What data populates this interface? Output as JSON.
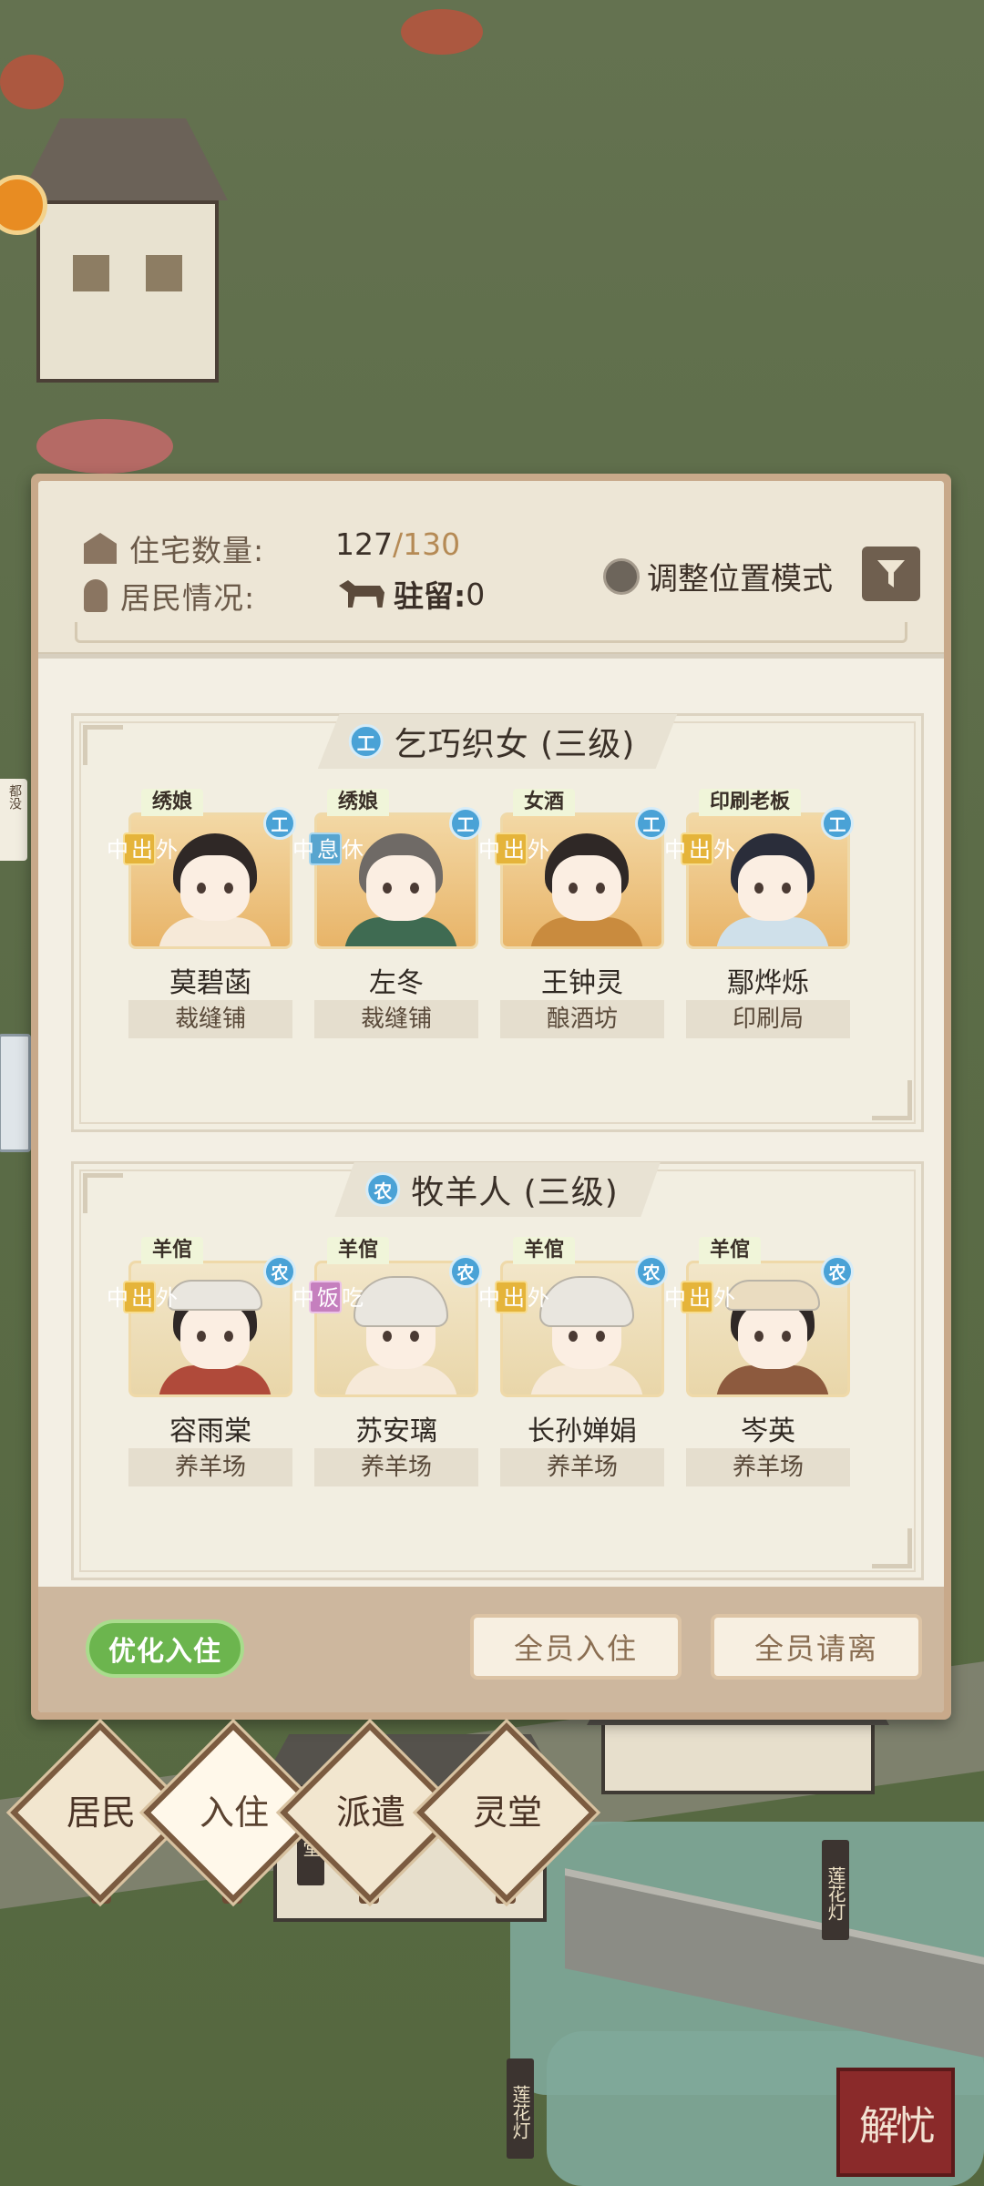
{
  "header": {
    "housing_label": "住宅数量:",
    "housing_count": "127",
    "housing_max": "/130",
    "residents_label": "居民情况:",
    "stay_label": "驻留:",
    "stay_value": "0",
    "adjust_mode_label": "调整位置模式"
  },
  "groups": [
    {
      "badge": "工",
      "title": "乞巧织女 (三级)",
      "members": [
        {
          "job": "绣娘",
          "status": "外出中",
          "badge": "工",
          "name": "莫碧菡",
          "place": "裁缝铺"
        },
        {
          "job": "绣娘",
          "status": "休息中",
          "badge": "工",
          "name": "左冬",
          "place": "裁缝铺"
        },
        {
          "job": "女酒",
          "status": "外出中",
          "badge": "工",
          "name": "王钟灵",
          "place": "酿酒坊"
        },
        {
          "job": "印刷老板",
          "status": "外出中",
          "badge": "工",
          "name": "鄢烨烁",
          "place": "印刷局"
        }
      ]
    },
    {
      "badge": "农",
      "title": "牧羊人 (三级)",
      "members": [
        {
          "job": "羊倌",
          "status": "外出中",
          "badge": "农",
          "name": "容雨棠",
          "place": "养羊场"
        },
        {
          "job": "羊倌",
          "status": "吃饭中",
          "badge": "农",
          "name": "苏安璃",
          "place": "养羊场"
        },
        {
          "job": "羊倌",
          "status": "外出中",
          "badge": "农",
          "name": "长孙婵娟",
          "place": "养羊场"
        },
        {
          "job": "羊倌",
          "status": "外出中",
          "badge": "农",
          "name": "岑英",
          "place": "养羊场"
        }
      ]
    }
  ],
  "footer": {
    "optimize_label": "优化入住",
    "all_move_in_label": "全员入住",
    "all_leave_label": "全员请离"
  },
  "nav": {
    "residents": "居民",
    "move_in": "入住",
    "dispatch": "派遣",
    "spirit_hall": "灵堂"
  },
  "scene": {
    "sign_peach": "桃堂",
    "sign_lantern1": "莲花灯",
    "sign_lantern2": "莲花灯",
    "side_tag": "都没",
    "seal": "解忧"
  },
  "colors": {
    "status_out": "#e5b43a",
    "status_rest": "#58a5cf",
    "status_eat": "#c57fbe",
    "badge": "#4aa2d6",
    "green_button": "#6cb54e"
  },
  "icons": [
    "house-icon",
    "person-icon",
    "horse-icon",
    "toggle-icon",
    "filter-icon"
  ]
}
